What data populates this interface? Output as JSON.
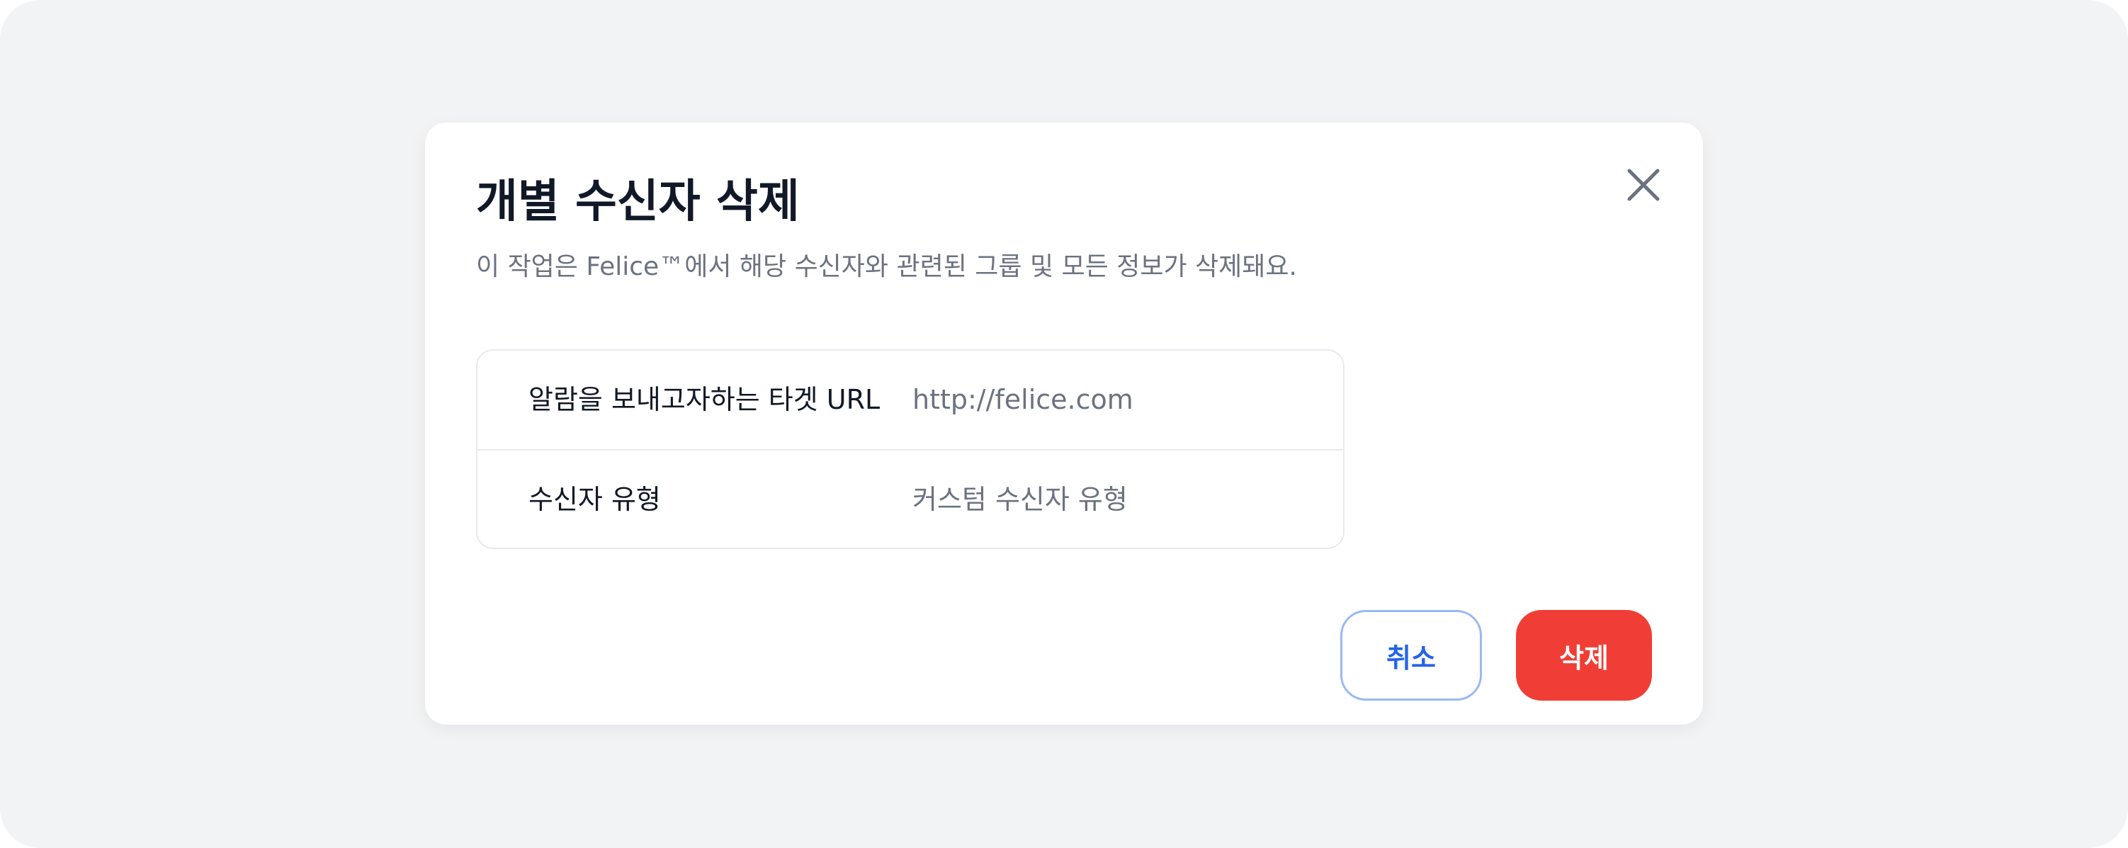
{
  "dialog": {
    "title": "개별 수신자 삭제",
    "description": "이 작업은 Felice™에서 해당 수신자와 관련된 그룹 및 모든 정보가 삭제돼요.",
    "close_icon": "close-icon",
    "details": [
      {
        "label": "알람을 보내고자하는 타겟 URL",
        "value": "http://felice.com"
      },
      {
        "label": "수신자 유형",
        "value": "커스텀 수신자 유형"
      }
    ],
    "cancel_label": "취소",
    "delete_label": "삭제"
  },
  "colors": {
    "backdrop": "#f2f3f5",
    "danger": "#f03e36",
    "primary": "#2563eb",
    "cancel_border": "#9bb9f3",
    "text_primary": "#111827",
    "text_secondary": "#6b7280"
  }
}
